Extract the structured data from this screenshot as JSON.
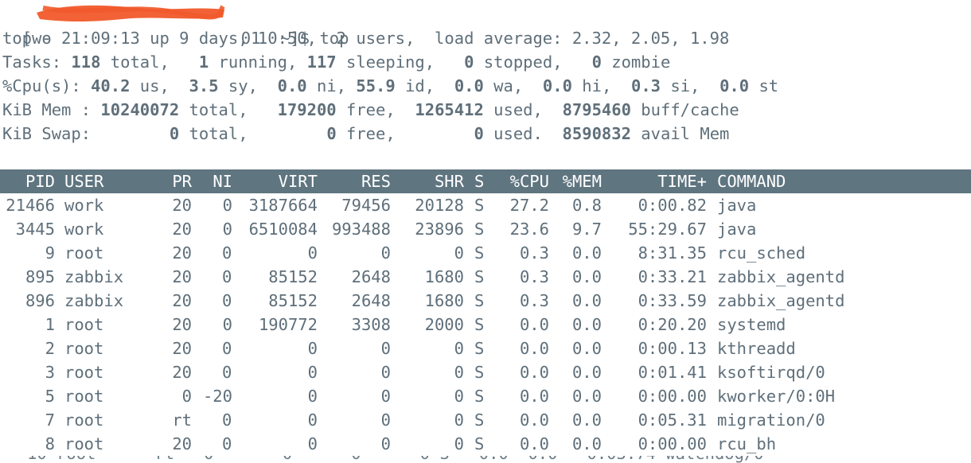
{
  "prompt": {
    "open_bracket": "[wo",
    "visible_fragment": "01",
    "tail": "~]$ top"
  },
  "summary": {
    "uptime_line": "top - 21:09:13 up 9 days, 10:50,  2 users,  load average: 2.32, 2.05, 1.98",
    "tasks": {
      "label": "Tasks: ",
      "total": "118",
      "total_lbl": " total,   ",
      "running": "1",
      "running_lbl": " running, ",
      "sleeping": "117",
      "sleeping_lbl": " sleeping,   ",
      "stopped": "0",
      "stopped_lbl": " stopped,   ",
      "zombie": "0",
      "zombie_lbl": " zombie"
    },
    "cpu": {
      "label": "%Cpu(s): ",
      "us": "40.2",
      "us_lbl": " us,  ",
      "sy": "3.5",
      "sy_lbl": " sy,  ",
      "ni": "0.0",
      "ni_lbl": " ni, ",
      "id": "55.9",
      "id_lbl": " id,  ",
      "wa": "0.0",
      "wa_lbl": " wa,  ",
      "hi": "0.0",
      "hi_lbl": " hi,  ",
      "si": "0.3",
      "si_lbl": " si,  ",
      "st": "0.0",
      "st_lbl": " st"
    },
    "mem": {
      "label": "KiB Mem : ",
      "total": "10240072",
      "total_lbl": " total,   ",
      "free": "179200",
      "free_lbl": " free,  ",
      "used": "1265412",
      "used_lbl": " used,  ",
      "buff": "8795460",
      "buff_lbl": " buff/cache"
    },
    "swap": {
      "label": "KiB Swap:        ",
      "total": "0",
      "total_lbl": " total,        ",
      "free": "0",
      "free_lbl": " free,        ",
      "used": "0",
      "used_lbl": " used.  ",
      "avail": "8590832",
      "avail_lbl": " avail Mem"
    }
  },
  "columns": [
    "PID",
    "USER",
    "PR",
    "NI",
    "VIRT",
    "RES",
    "SHR",
    "S",
    "%CPU",
    "%MEM",
    "TIME+",
    "COMMAND"
  ],
  "processes": [
    {
      "pid": "21466",
      "user": "work",
      "pr": "20",
      "ni": "0",
      "virt": "3187664",
      "res": "79456",
      "shr": "20128",
      "s": "S",
      "cpu": "27.2",
      "mem": "0.8",
      "time": "0:00.82",
      "command": "java"
    },
    {
      "pid": "3445",
      "user": "work",
      "pr": "20",
      "ni": "0",
      "virt": "6510084",
      "res": "993488",
      "shr": "23896",
      "s": "S",
      "cpu": "23.6",
      "mem": "9.7",
      "time": "55:29.67",
      "command": "java"
    },
    {
      "pid": "9",
      "user": "root",
      "pr": "20",
      "ni": "0",
      "virt": "0",
      "res": "0",
      "shr": "0",
      "s": "S",
      "cpu": "0.3",
      "mem": "0.0",
      "time": "8:31.35",
      "command": "rcu_sched"
    },
    {
      "pid": "895",
      "user": "zabbix",
      "pr": "20",
      "ni": "0",
      "virt": "85152",
      "res": "2648",
      "shr": "1680",
      "s": "S",
      "cpu": "0.3",
      "mem": "0.0",
      "time": "0:33.21",
      "command": "zabbix_agentd"
    },
    {
      "pid": "896",
      "user": "zabbix",
      "pr": "20",
      "ni": "0",
      "virt": "85152",
      "res": "2648",
      "shr": "1680",
      "s": "S",
      "cpu": "0.3",
      "mem": "0.0",
      "time": "0:33.59",
      "command": "zabbix_agentd"
    },
    {
      "pid": "1",
      "user": "root",
      "pr": "20",
      "ni": "0",
      "virt": "190772",
      "res": "3308",
      "shr": "2000",
      "s": "S",
      "cpu": "0.0",
      "mem": "0.0",
      "time": "0:20.20",
      "command": "systemd"
    },
    {
      "pid": "2",
      "user": "root",
      "pr": "20",
      "ni": "0",
      "virt": "0",
      "res": "0",
      "shr": "0",
      "s": "S",
      "cpu": "0.0",
      "mem": "0.0",
      "time": "0:00.13",
      "command": "kthreadd"
    },
    {
      "pid": "3",
      "user": "root",
      "pr": "20",
      "ni": "0",
      "virt": "0",
      "res": "0",
      "shr": "0",
      "s": "S",
      "cpu": "0.0",
      "mem": "0.0",
      "time": "0:01.41",
      "command": "ksoftirqd/0"
    },
    {
      "pid": "5",
      "user": "root",
      "pr": "0",
      "ni": "-20",
      "virt": "0",
      "res": "0",
      "shr": "0",
      "s": "S",
      "cpu": "0.0",
      "mem": "0.0",
      "time": "0:00.00",
      "command": "kworker/0:0H"
    },
    {
      "pid": "7",
      "user": "root",
      "pr": "rt",
      "ni": "0",
      "virt": "0",
      "res": "0",
      "shr": "0",
      "s": "S",
      "cpu": "0.0",
      "mem": "0.0",
      "time": "0:05.31",
      "command": "migration/0"
    },
    {
      "pid": "8",
      "user": "root",
      "pr": "20",
      "ni": "0",
      "virt": "0",
      "res": "0",
      "shr": "0",
      "s": "S",
      "cpu": "0.0",
      "mem": "0.0",
      "time": "0:00.00",
      "command": "rcu_bh"
    }
  ],
  "colors": {
    "text": "#5f6f7a",
    "header_bg": "#5f7580",
    "header_text": "#ffffff",
    "redaction": "#f15a2b"
  },
  "icons": {
    "redaction": "redaction-scribble"
  }
}
